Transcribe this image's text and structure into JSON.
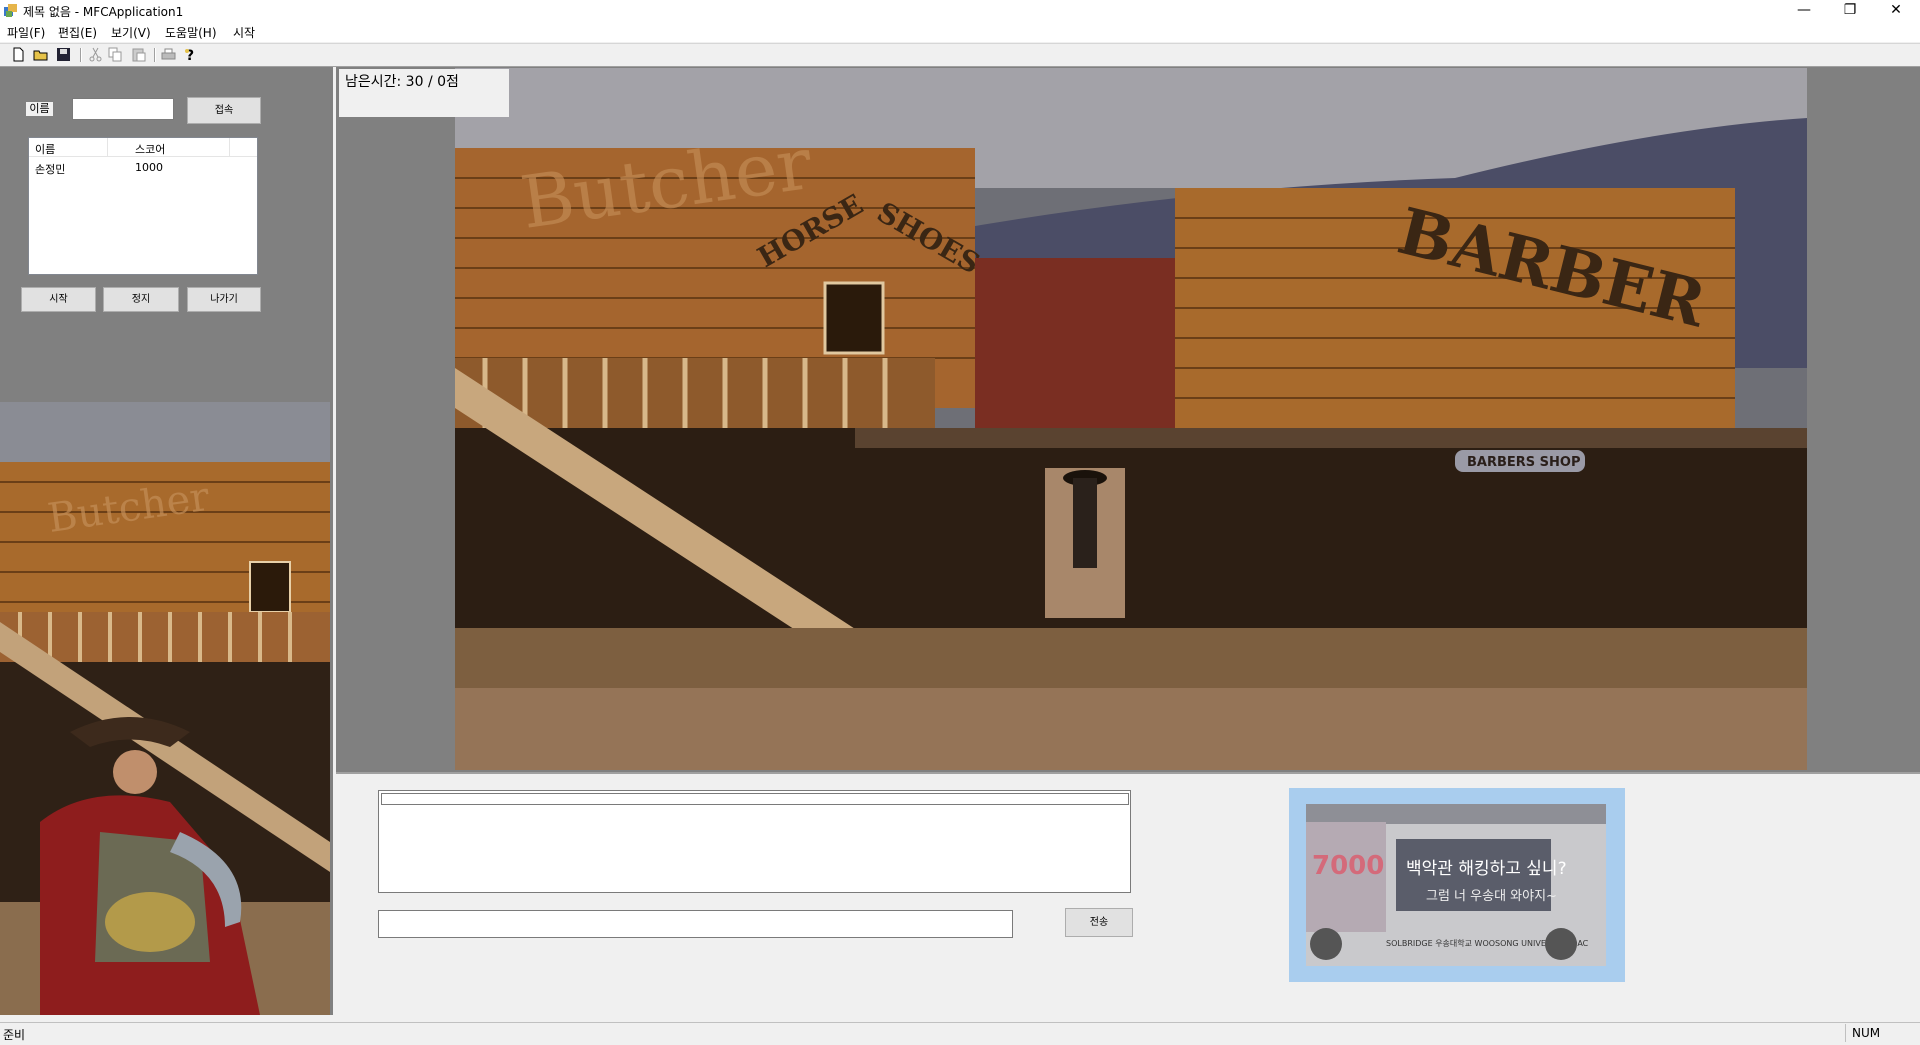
{
  "window": {
    "title": "제목 없음 - MFCApplication1",
    "minimize": "—",
    "maximize": "❐",
    "close": "✕"
  },
  "menu": {
    "items": [
      "파일(F)",
      "편집(E)",
      "보기(V)",
      "도움말(H)",
      "시작"
    ]
  },
  "toolbar": {
    "icons": [
      "new-file-icon",
      "open-folder-icon",
      "save-icon",
      "cut-icon",
      "copy-icon",
      "paste-icon",
      "print-icon",
      "help-icon"
    ]
  },
  "login": {
    "name_label": "이름",
    "name_value": "",
    "connect_button": "접속"
  },
  "score_list": {
    "columns": [
      "이름",
      "스코어"
    ],
    "rows": [
      {
        "name": "손정민",
        "score": "1000"
      }
    ]
  },
  "controls": {
    "start_button": "시작",
    "stop_button": "정지",
    "exit_button": "나가기"
  },
  "game": {
    "timer_text": "남은시간: 30 / 0점",
    "shop_signs": [
      "Butcher",
      "HORSE",
      "SHOES",
      "BARBER",
      "BARBERS SHOP"
    ]
  },
  "chat": {
    "log_text": "",
    "input_value": "",
    "send_button": "전송"
  },
  "ad": {
    "headline": "백악관 해킹하고 싶니?",
    "subline": "그럼 너 우송대 와야지~",
    "bus_number": "7000",
    "footer": "SOLBRIDGE 우송대학교 WOOSONG UNIVERSITY OAC"
  },
  "status": {
    "left": "준비",
    "right": "NUM"
  },
  "colors": {
    "panel_gray": "#808080",
    "ad_border": "#a9cdee",
    "background": "#f0f0f0"
  }
}
